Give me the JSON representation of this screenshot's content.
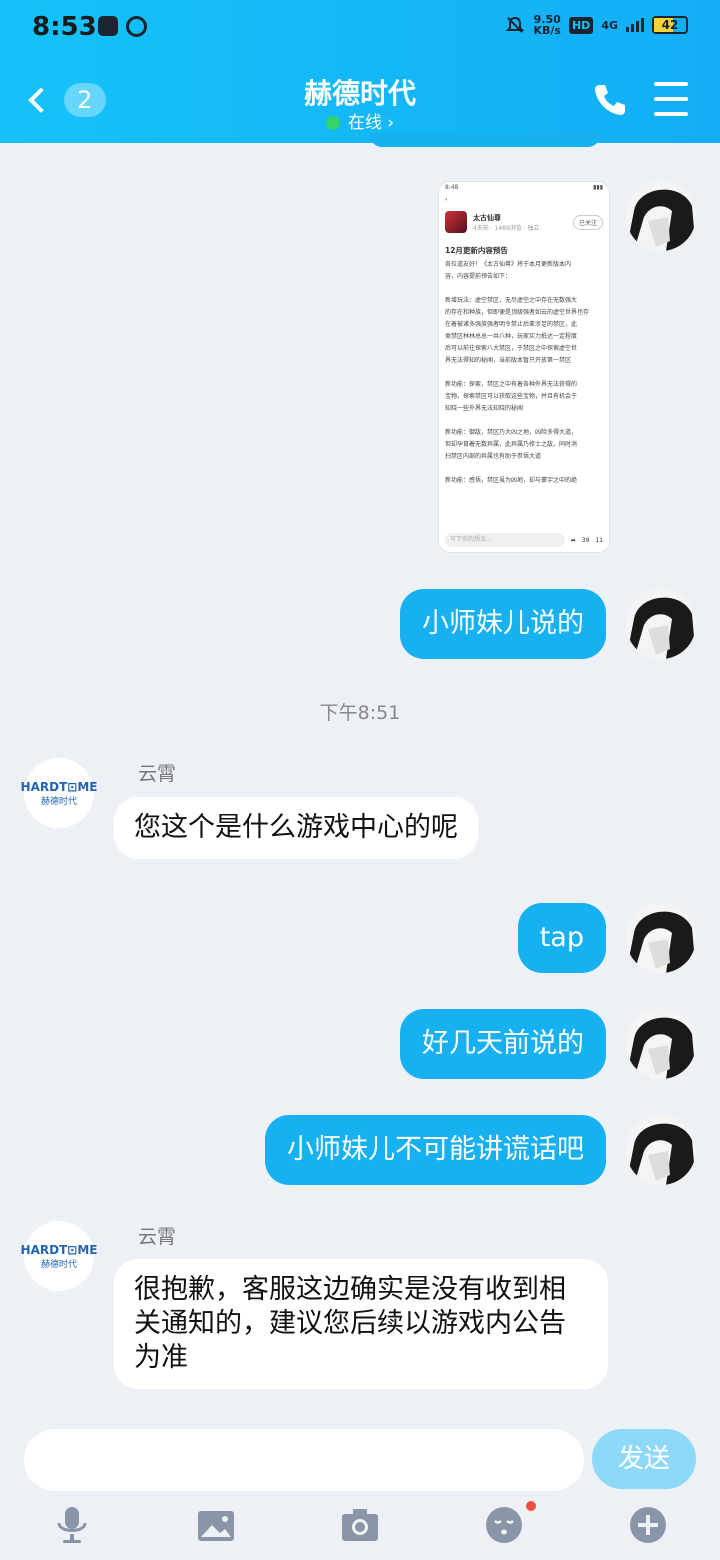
{
  "status_bar": {
    "time": "8:53",
    "net_speed_value": "9.50",
    "net_speed_unit": "KB/s",
    "hd": "HD",
    "network": "4G",
    "battery": "42"
  },
  "header": {
    "back_badge": "2",
    "title": "赫德时代",
    "status": "在线 ›"
  },
  "chat": {
    "image_message": {
      "status_time": "8:48",
      "game_name": "太古仙尊",
      "game_meta": "4天前 · 1489浏览 · 独立",
      "follow": "已关注",
      "post_title": "12月更新内容预告",
      "lines": [
        "各位道友好！《太古仙尊》将于本月更新版本内",
        "容，内容提前预告如下：",
        "",
        "新增玩法：虚空禁区，无尽虚空之中存在无数强大",
        "的存在和种族，但即便是顶级强者如云的虚空世界也存",
        "在着被诸多强族强者明令禁止后辈涉足的禁区，此",
        "类禁区林林总总一共八种，玩家实力抵达一定程度",
        "后可以前往探索八大禁区，于禁区之中探索虚空世",
        "界无法得知的秘闻，当前版本暂只开放第一禁区",
        "",
        "新功能：探索，禁区之中有着各种外界无法获得的",
        "宝物，探索禁区可以获取这些宝物，并且有机会于",
        "知晓一些外界无法知晓的秘闻",
        "",
        "新功能：御敌，禁区乃大凶之地，凶险多得大道，",
        "但却孕育着无数异属，此异属乃修士之敌，同时消",
        "扫禁区内部的异属也有助于参悟大道",
        "",
        "新功能：感悟，禁区虽为凶地，却与寰宇之中的绝"
      ],
      "comment_placeholder": "写下你的想法...",
      "like_count": "11",
      "comment_count": "39"
    },
    "messages": {
      "m1": "小师妹儿说的",
      "timestamp": "下午8:51",
      "sender1": "云霄",
      "m2": "您这个是什么游戏中心的呢",
      "m3": "tap",
      "m4": "好几天前说的",
      "m5": "小师妹儿不可能讲谎话吧",
      "sender2": "云霄",
      "m6": "很抱歉，客服这边确实是没有收到相关通知的，建议您后续以游戏内公告为准"
    },
    "service_logo": {
      "top": "HARDT⊡ME",
      "bottom": "赫德时代"
    }
  },
  "composer": {
    "input_value": "",
    "send_label": "发送"
  },
  "colors": {
    "accent": "#17b1f2",
    "background": "#edf0f5",
    "presence": "#33d46a"
  }
}
